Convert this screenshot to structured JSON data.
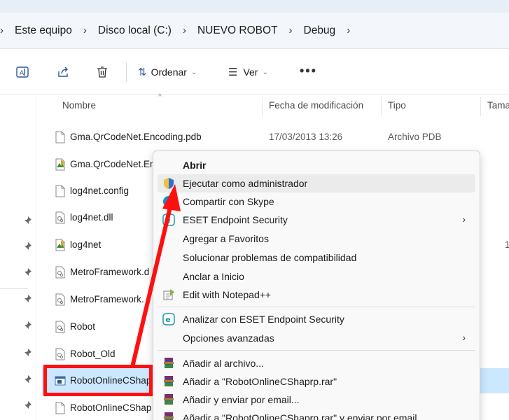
{
  "breadcrumb": {
    "items": [
      "Este equipo",
      "Disco local (C:)",
      "NUEVO ROBOT",
      "Debug"
    ]
  },
  "toolbar": {
    "sort_label": "Ordenar",
    "view_label": "Ver",
    "more_label": "•••"
  },
  "columns": {
    "name": "Nombre",
    "date": "Fecha de modificación",
    "type": "Tipo",
    "size": "Tama"
  },
  "files": [
    {
      "name": "Gma.QrCodeNet.Encoding.pdb",
      "date": "17/03/2013 13:26",
      "type": "Archivo PDB",
      "size": "",
      "icon": "blank-file-icon"
    },
    {
      "name": "Gma.QrCodeNet.En",
      "date": "",
      "type": "",
      "size": "",
      "icon": "xml-doc-icon"
    },
    {
      "name": "log4net.config",
      "date": "",
      "type": "",
      "size": "",
      "icon": "blank-file-icon"
    },
    {
      "name": "log4net.dll",
      "date": "",
      "type": "",
      "size": "",
      "icon": "dll-file-icon"
    },
    {
      "name": "log4net",
      "date": "",
      "type": "",
      "size": "1",
      "icon": "xml-doc-icon"
    },
    {
      "name": "MetroFramework.d",
      "date": "",
      "type": "",
      "size": "",
      "icon": "dll-file-icon"
    },
    {
      "name": "MetroFramework.",
      "date": "",
      "type": "",
      "size": "",
      "icon": "dll-file-icon"
    },
    {
      "name": "Robot",
      "date": "",
      "type": "",
      "size": "",
      "icon": "dll-file-icon"
    },
    {
      "name": "Robot_Old",
      "date": "",
      "type": "",
      "size": "",
      "icon": "dll-file-icon"
    },
    {
      "name": "RobotOnlineCShap",
      "date": "",
      "type": "",
      "size": "",
      "icon": "exe-app-icon"
    },
    {
      "name": "RobotOnlineCShap",
      "date": "",
      "type": "",
      "size": "",
      "icon": "blank-file-icon"
    }
  ],
  "context_menu": {
    "items": [
      {
        "label": "Abrir",
        "bold": true,
        "icon": "",
        "submenu": false
      },
      {
        "label": "Ejecutar como administrador",
        "bold": false,
        "icon": "uac-shield-icon",
        "submenu": false
      },
      {
        "label": "Compartir con Skype",
        "bold": false,
        "icon": "skype-icon",
        "submenu": false
      },
      {
        "label": "ESET Endpoint Security",
        "bold": false,
        "icon": "eset-icon",
        "submenu": true
      },
      {
        "label": "Agregar a Favoritos",
        "bold": false,
        "icon": "",
        "submenu": false
      },
      {
        "label": "Solucionar problemas de compatibilidad",
        "bold": false,
        "icon": "",
        "submenu": false
      },
      {
        "label": "Anclar a Inicio",
        "bold": false,
        "icon": "",
        "submenu": false
      },
      {
        "label": "Edit with Notepad++",
        "bold": false,
        "icon": "notepad-plus-icon",
        "submenu": false
      },
      {
        "label": "Analizar con ESET Endpoint Security",
        "bold": false,
        "icon": "eset-icon",
        "submenu": false
      },
      {
        "label": "Opciones avanzadas",
        "bold": false,
        "icon": "",
        "submenu": true
      },
      {
        "label": "Añadir al archivo...",
        "bold": false,
        "icon": "winrar-icon",
        "submenu": false
      },
      {
        "label": "Añadir a \"RobotOnlineCShaprp.rar\"",
        "bold": false,
        "icon": "winrar-icon",
        "submenu": false
      },
      {
        "label": "Añadir y enviar por email...",
        "bold": false,
        "icon": "winrar-icon",
        "submenu": false
      },
      {
        "label": "Añadir a \"RobotOnlineCShaprp.rar\" y enviar por email",
        "bold": false,
        "icon": "winrar-icon",
        "submenu": false
      }
    ]
  },
  "colors": {
    "selection": "#cce8ff",
    "highlight": "#ff1010",
    "accent": "#2b5797"
  }
}
